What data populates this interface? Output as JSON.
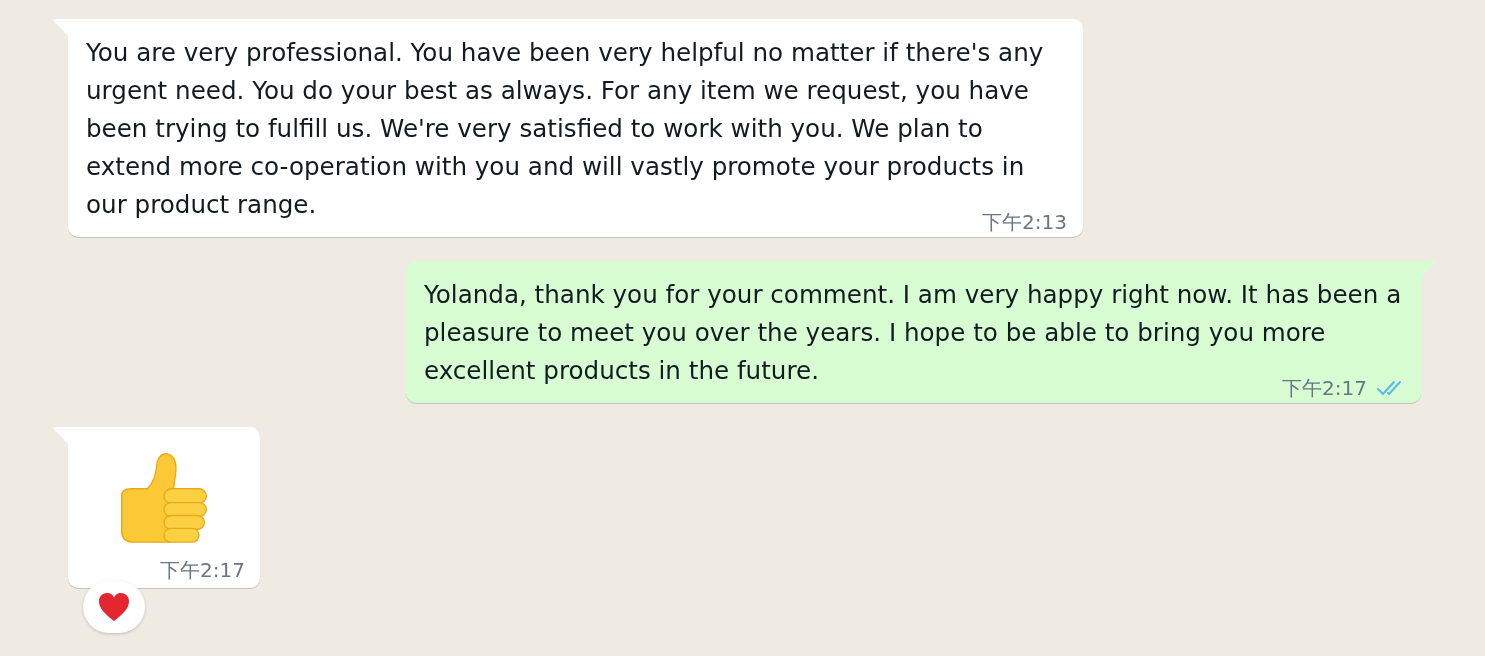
{
  "messages": [
    {
      "outgoing": false,
      "kind": "text",
      "text": "You are very professional. You have been very helpful no matter if there's any urgent need. You do your best as always. For any item we request, you have been trying to fulfill us. We're very satisfied to work with you. We plan to extend more co-operation with you and will vastly promote your products in our product range.",
      "time": "下午2:13",
      "reacted": false
    },
    {
      "outgoing": true,
      "kind": "text",
      "text": "Yolanda, thank you for your comment. I am very happy right now. It has been a pleasure to meet you over the years. I hope to be able to bring you more excellent products in the future.",
      "time": "下午2:17",
      "read": true,
      "reacted": false
    },
    {
      "outgoing": false,
      "kind": "emoji",
      "time": "下午2:17",
      "reacted": true
    }
  ]
}
